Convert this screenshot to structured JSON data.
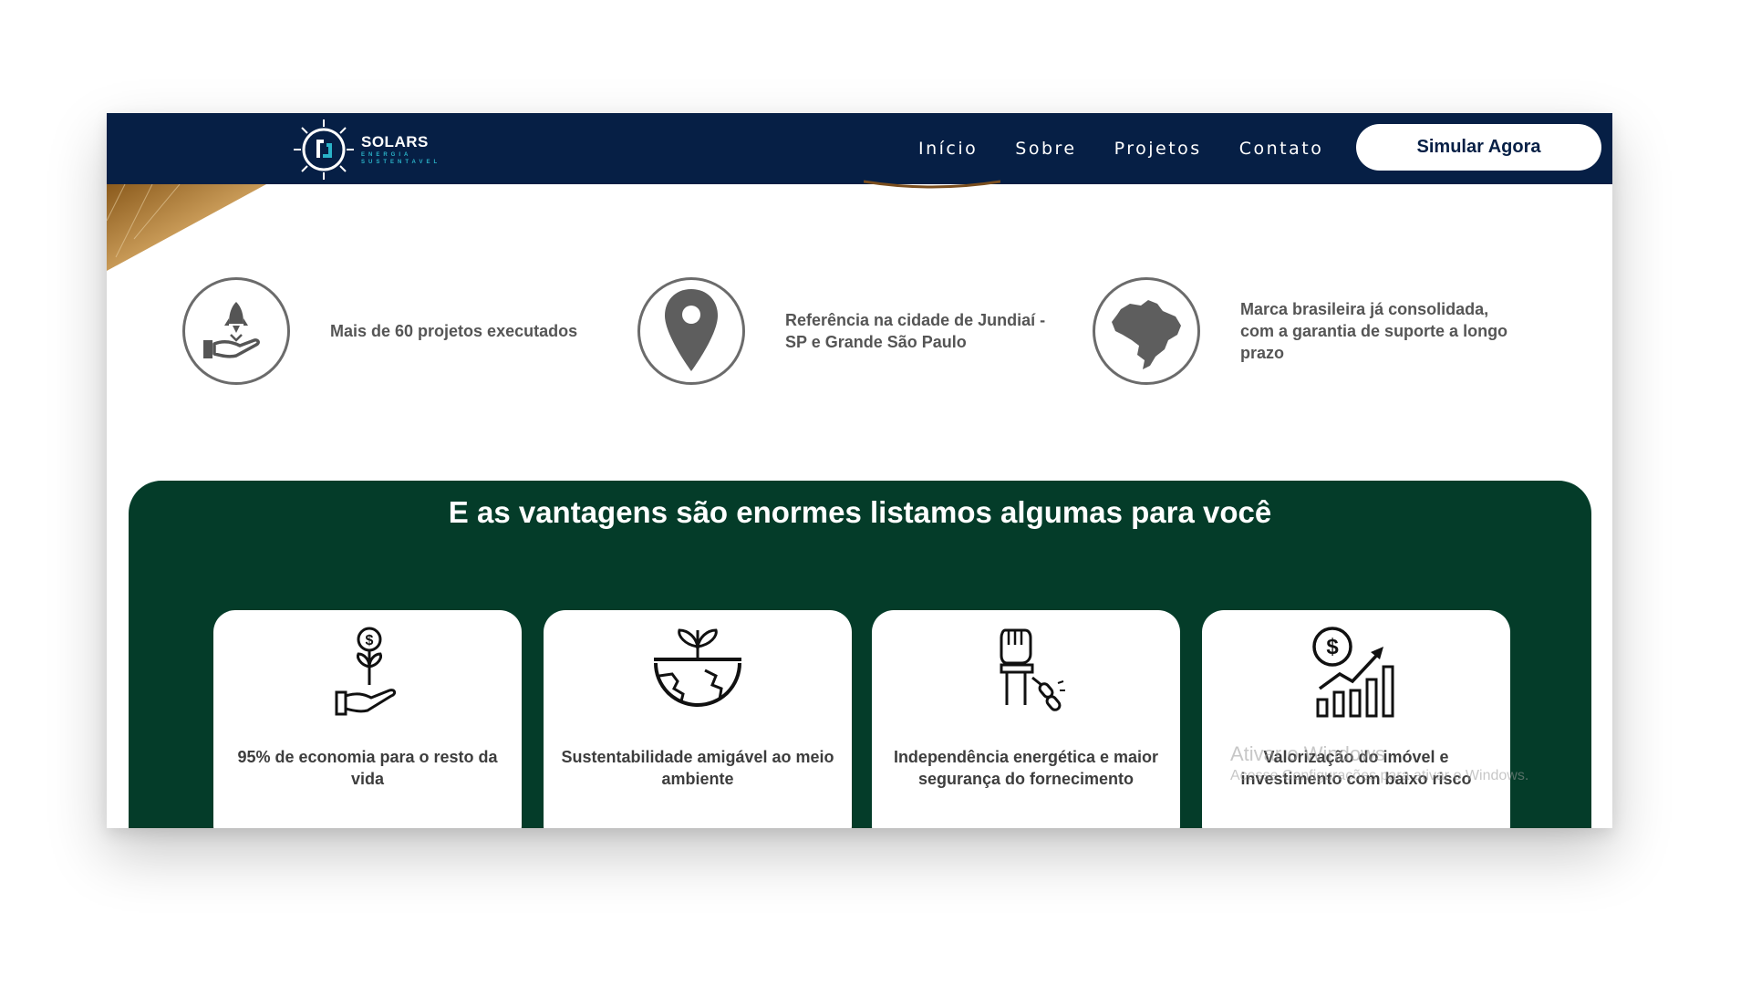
{
  "header": {
    "logo_name": "SOLARS",
    "logo_tagline_1": "ENERGIA",
    "logo_tagline_2": "SUSTENTAVEL",
    "menu": [
      "Início",
      "Sobre",
      "Projetos",
      "Contato"
    ],
    "cta_label": "Simular Agora"
  },
  "features": [
    {
      "icon": "rocket-hand-icon",
      "text": "Mais de 60 projetos executados"
    },
    {
      "icon": "location-pin-icon",
      "text": "Referência na cidade de Jundiaí - SP e Grande São Paulo"
    },
    {
      "icon": "brazil-map-icon",
      "text": "Marca brasileira já consolidada, com a garantia de suporte a longo prazo"
    }
  ],
  "advantages": {
    "title": "E as vantagens são enormes listamos algumas para você",
    "cards": [
      {
        "icon": "money-plant-hand-icon",
        "text": "95% de economia para o resto da vida"
      },
      {
        "icon": "earth-sprout-icon",
        "text": "Sustentabilidade amigável ao meio ambiente"
      },
      {
        "icon": "broken-chain-fist-icon",
        "text": "Independência energética e maior segurança do fornecimento"
      },
      {
        "icon": "growth-chart-icon",
        "text": "Valorização do imóvel e investimento com baixo risco"
      }
    ]
  },
  "watermark": {
    "line1": "Ativar o Windows",
    "line2": "Acesse Configurações para ativar o Windows."
  },
  "colors": {
    "navy": "#061f45",
    "green": "#043c29",
    "accent_teal": "#2ab3c8"
  }
}
